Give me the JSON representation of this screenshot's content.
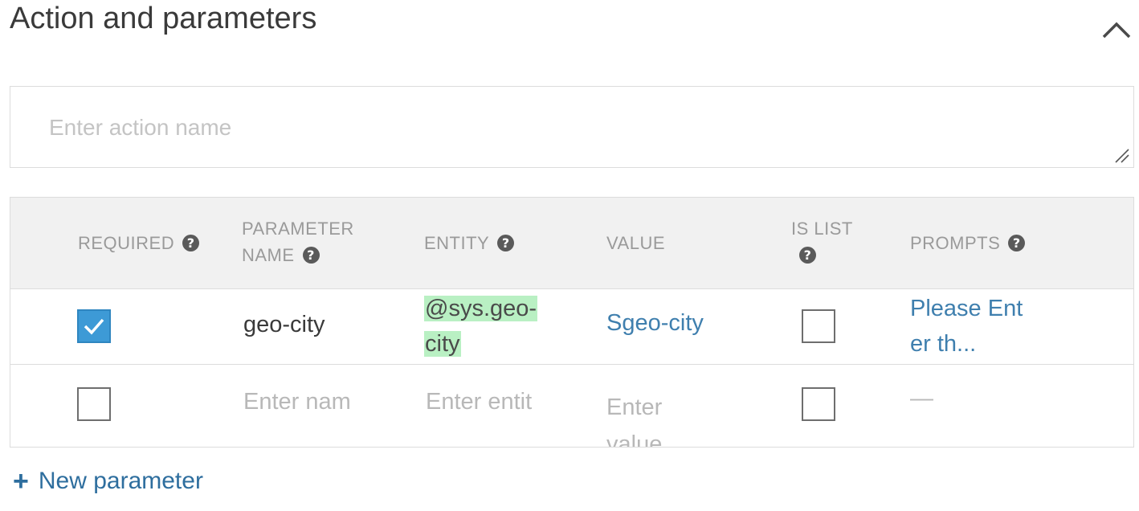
{
  "section": {
    "title": "Action and parameters"
  },
  "action": {
    "placeholder": "Enter action name"
  },
  "table": {
    "headers": {
      "required": "REQUIRED",
      "parameter_name_line1": "PARAMETER",
      "parameter_name_line2": "NAME",
      "entity": "ENTITY",
      "value": "VALUE",
      "is_list": "IS LIST",
      "prompts": "PROMPTS"
    },
    "help_glyph": "?",
    "rows": [
      {
        "required": true,
        "parameter_name": "geo-city",
        "entity_line1": "@sys.geo-",
        "entity_line2": "city",
        "value": "Sgeo-city",
        "is_list": false,
        "prompt_line1": "Please Ent",
        "prompt_line2": "er th..."
      },
      {
        "required": false,
        "parameter_name_placeholder": "Enter nam",
        "entity_placeholder": "Enter entit",
        "value_placeholder_line1": "Enter",
        "value_placeholder_line2": "value",
        "is_list": false,
        "prompt": "—"
      }
    ]
  },
  "new_parameter": {
    "icon": "+",
    "label": "New parameter"
  },
  "colors": {
    "checkbox_checked": "#3d9ad6",
    "entity_highlight": "#b9f0c3",
    "link": "#3f7fae",
    "header_bg": "#f1f1f1"
  }
}
